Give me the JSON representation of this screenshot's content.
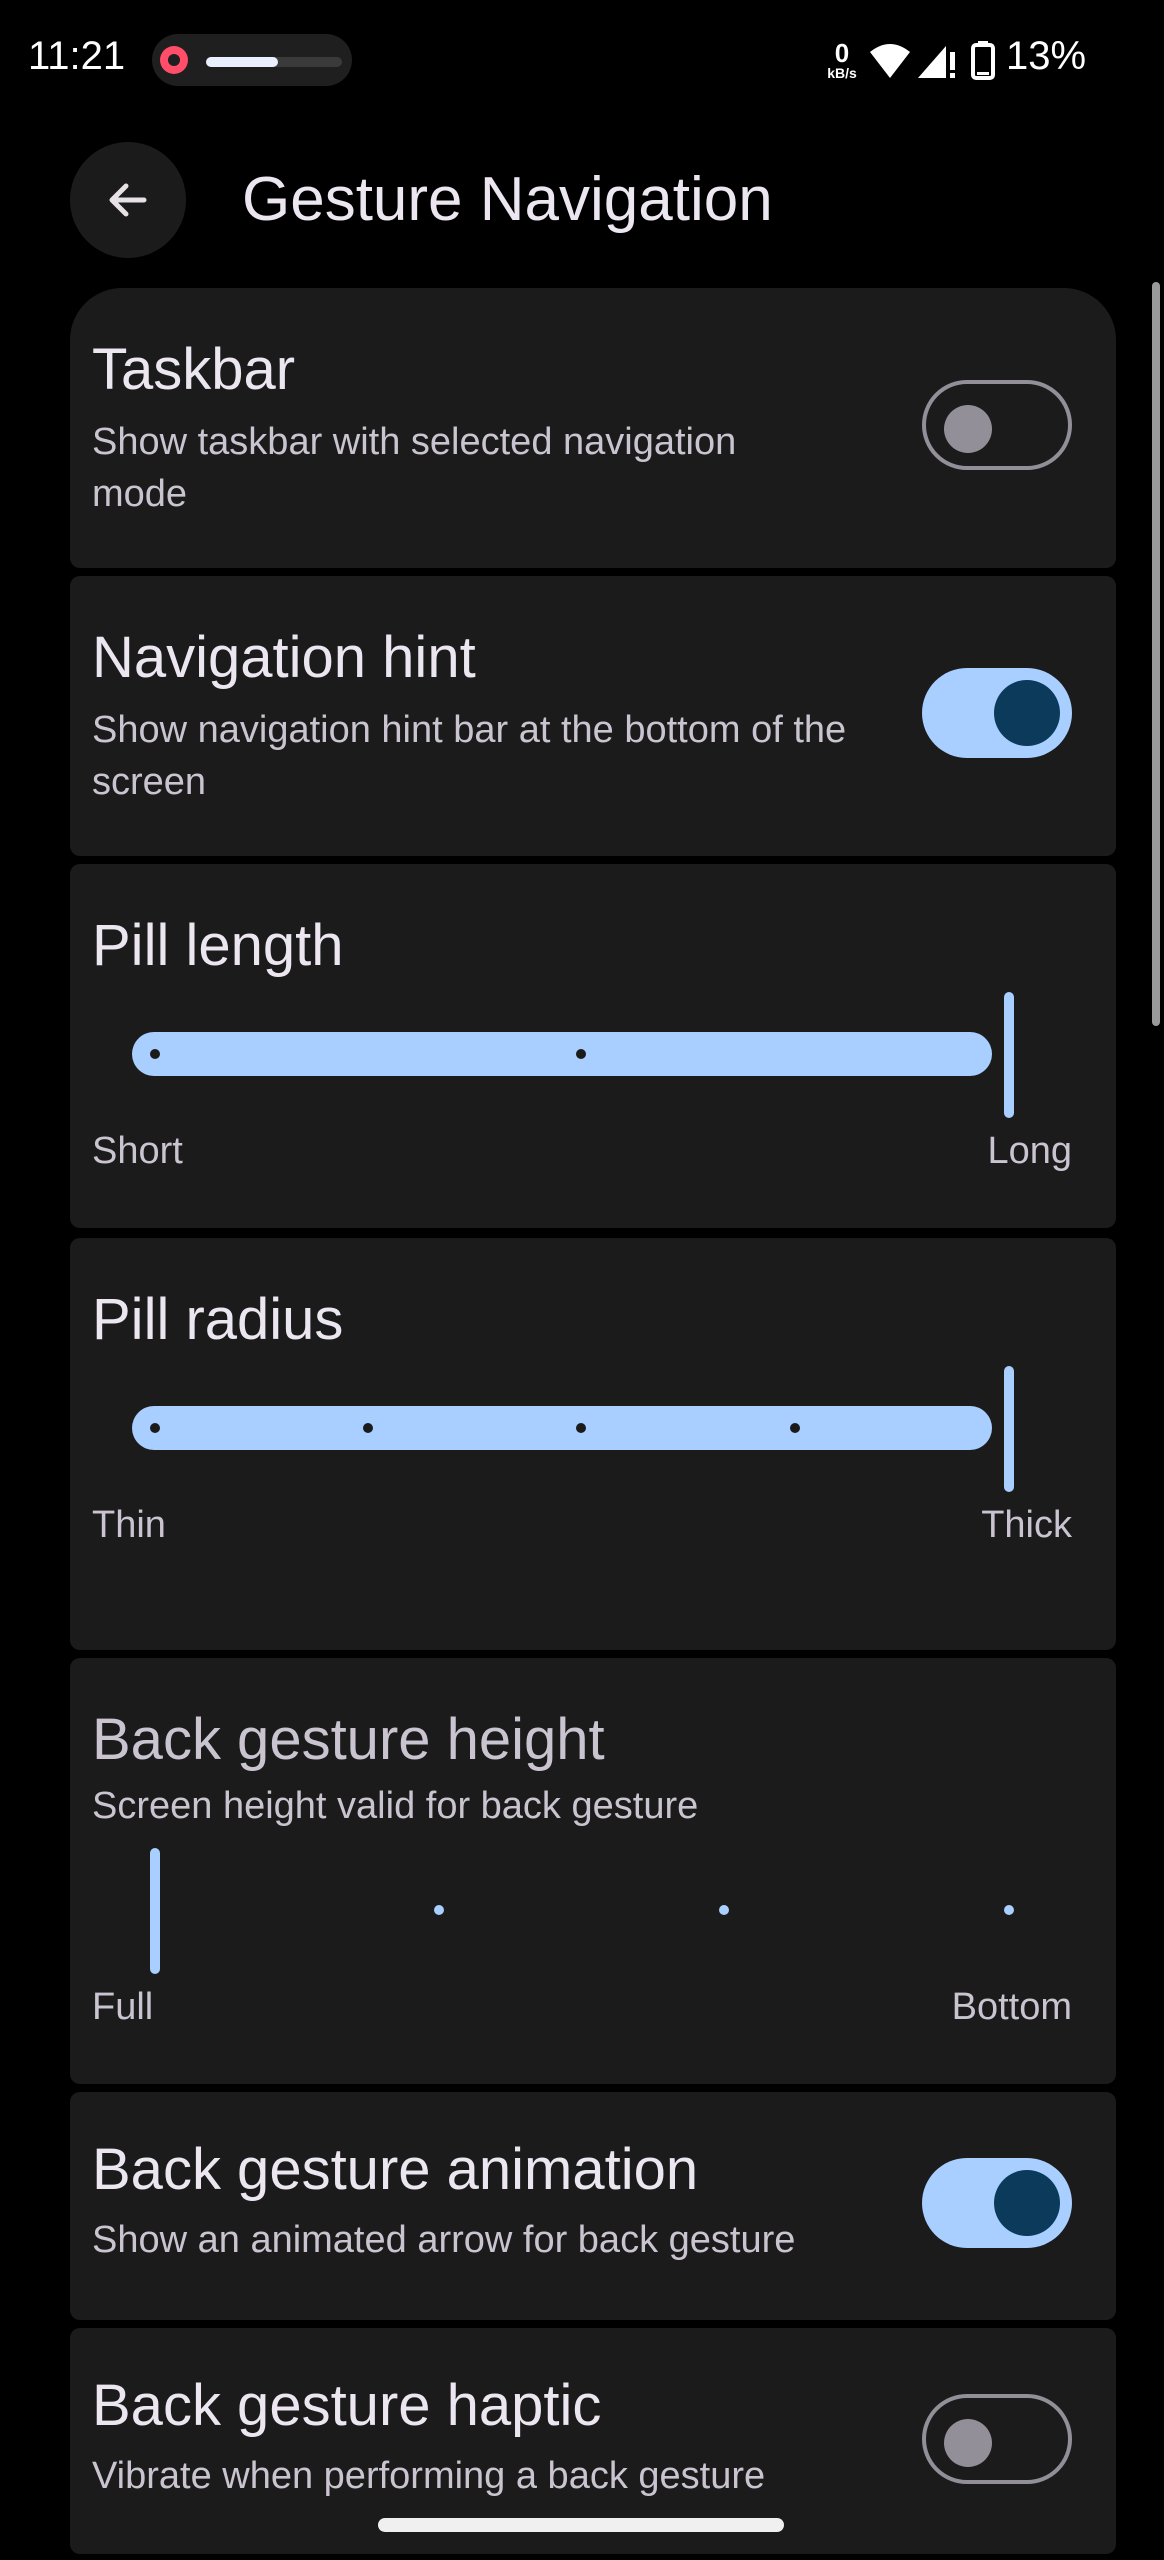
{
  "status_bar": {
    "time": "11:21",
    "net_speed_value": "0",
    "net_speed_unit": "kB/s",
    "battery": "13%",
    "icons": [
      "screen-record-icon",
      "wifi-icon",
      "signal-icon",
      "battery-icon"
    ],
    "recording_progress": 0.55
  },
  "header": {
    "title": "Gesture Navigation",
    "back_icon": "arrow-left-icon"
  },
  "settings": {
    "taskbar": {
      "title": "Taskbar",
      "desc": "Show taskbar with selected navigation mode",
      "enabled": false
    },
    "navigation_hint": {
      "title": "Navigation hint",
      "desc": "Show navigation hint bar at the bottom of the screen",
      "enabled": true
    },
    "pill_length": {
      "title": "Pill length",
      "min_label": "Short",
      "max_label": "Long",
      "value": 1.0,
      "steps": 3
    },
    "pill_radius": {
      "title": "Pill radius",
      "min_label": "Thin",
      "max_label": "Thick",
      "value": 1.0,
      "steps": 5
    },
    "back_gesture_height": {
      "title": "Back gesture height",
      "desc": "Screen height valid for back gesture",
      "min_label": "Full",
      "max_label": "Bottom",
      "value": 0.0,
      "steps": 4
    },
    "back_gesture_animation": {
      "title": "Back gesture animation",
      "desc": "Show an animated arrow for back gesture",
      "enabled": true
    },
    "back_gesture_haptic": {
      "title": "Back gesture haptic",
      "desc": "Vibrate when performing a back gesture",
      "enabled": false
    }
  },
  "colors": {
    "accent": "#a8cfff",
    "knob_dark": "#0b3a5a",
    "card_bg": "#1b1b1b",
    "background": "#000000"
  }
}
